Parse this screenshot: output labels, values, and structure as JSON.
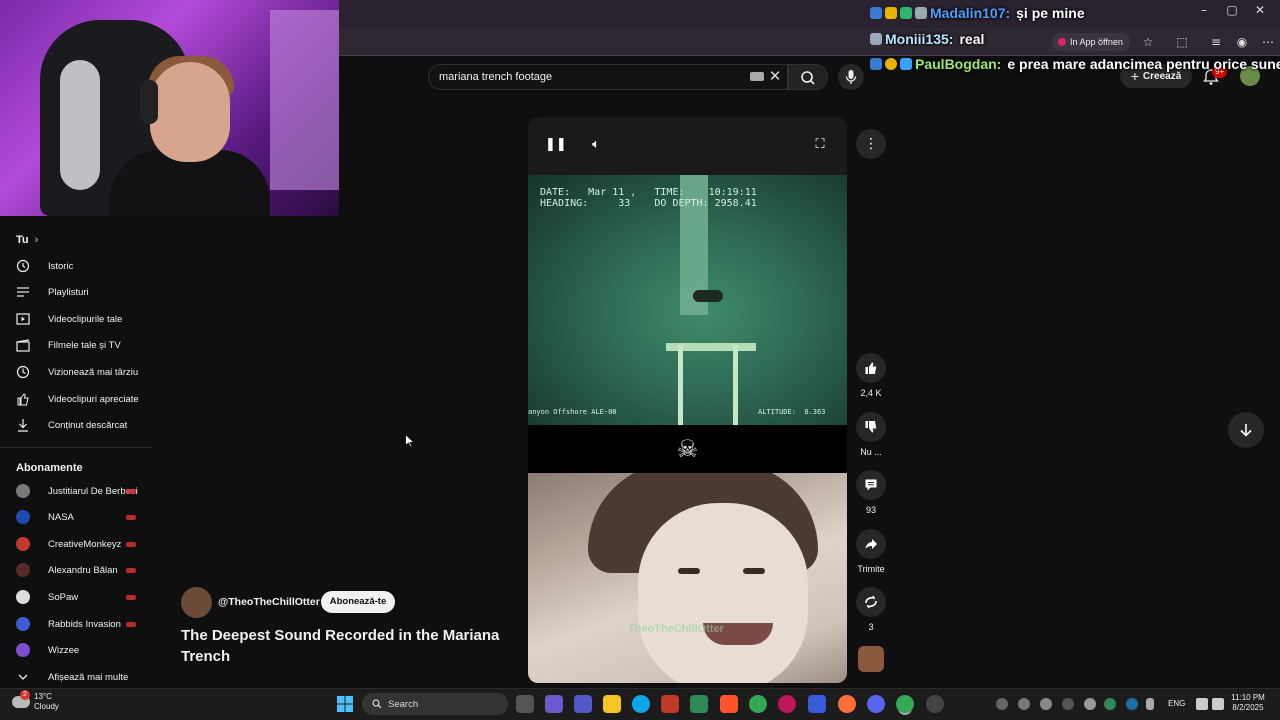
{
  "browser": {
    "open_in_app_label": "In App öffnen"
  },
  "chat": [
    {
      "user": "Madalin107:",
      "message": "și pe mine",
      "color": "#4ea1ff"
    },
    {
      "user": "Moniii135:",
      "message": "real",
      "color": "#b8e8ff"
    },
    {
      "user": "PaulBogdan:",
      "message": "e prea mare adancimea pentru orice sunet",
      "color": "#9fe870"
    }
  ],
  "header": {
    "search_query": "mariana trench footage",
    "create_label": "Creează",
    "notification_count": "9+"
  },
  "sidebar": {
    "you_section": "Tu",
    "you_items": [
      {
        "label": "Istoric",
        "icon": "history-icon"
      },
      {
        "label": "Playlisturi",
        "icon": "playlist-icon"
      },
      {
        "label": "Videoclipurile tale",
        "icon": "your-videos-icon"
      },
      {
        "label": "Filmele tale și TV",
        "icon": "movies-icon"
      },
      {
        "label": "Vizionează mai târziu",
        "icon": "watch-later-icon"
      },
      {
        "label": "Videoclipuri apreciate",
        "icon": "liked-icon"
      },
      {
        "label": "Conținut descărcat",
        "icon": "download-icon"
      }
    ],
    "subs_section": "Abonamente",
    "subscriptions": [
      {
        "label": "Justitiarul De Berbeci",
        "color": "#7a7a7a"
      },
      {
        "label": "NASA",
        "color": "#1f4bb5"
      },
      {
        "label": "CreativeMonkeyz",
        "color": "#c0392b"
      },
      {
        "label": "Alexandru Bălan",
        "color": "#5a2a2a"
      },
      {
        "label": "SoPaw",
        "color": "#dddddd"
      },
      {
        "label": "Rabbids Invasion",
        "color": "#3a5fcf"
      },
      {
        "label": "Wizzee",
        "color": "#7b4fd0"
      }
    ],
    "show_more": "Afișează mai multe"
  },
  "player": {
    "osd_line1": "DATE:   Mar 11 ,   TIME:    10:19:11",
    "osd_line2": "HEADING:     33    DO DEPTH: 2958.41",
    "osd_footer_left": "anyon Offshore ALE-08",
    "osd_footer_right": "ALTITUDE:  8.363",
    "skull": "☠",
    "watermark": "TheoTheChillOtter"
  },
  "actions": {
    "like_count": "2,4 K",
    "dislike_label": "Nu ...",
    "comment_count": "93",
    "share_label": "Trimite",
    "remix_count": "3"
  },
  "video": {
    "channel": "@TheoTheChillOtter",
    "subscribe_label": "Abonează-te",
    "title": "The Deepest Sound Recorded in the Mariana Trench"
  },
  "taskbar": {
    "temperature": "13°C",
    "weather": "Cloudy",
    "weather_badge": "2",
    "search_label": "Search",
    "language": "ENG",
    "time": "11:10 PM",
    "date": "8/2/2025"
  }
}
